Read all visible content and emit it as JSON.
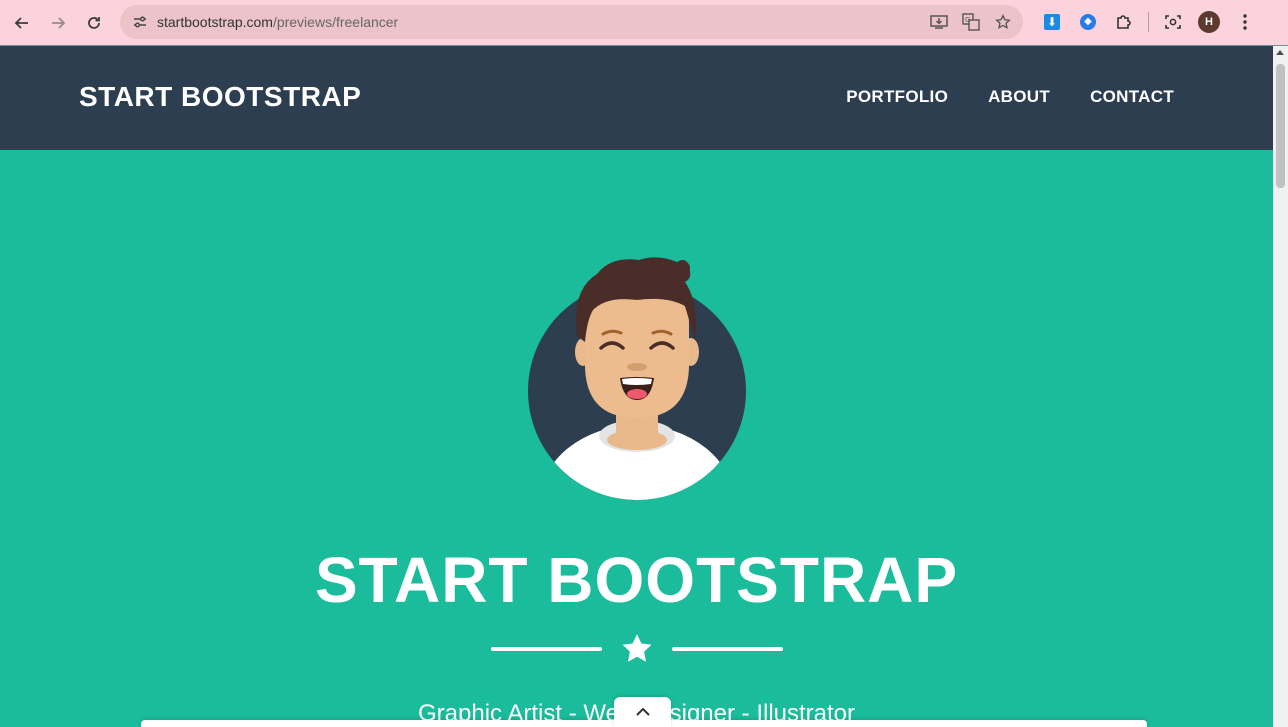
{
  "browser": {
    "url_host": "startbootstrap.com",
    "url_path": "/previews/freelancer",
    "profile_initial": "H"
  },
  "navbar": {
    "brand": "START BOOTSTRAP",
    "links": [
      "PORTFOLIO",
      "ABOUT",
      "CONTACT"
    ]
  },
  "hero": {
    "title": "START BOOTSTRAP",
    "subtitle": "Graphic Artist - Web Designer - Illustrator"
  },
  "colors": {
    "primary": "#1abc9c",
    "navbar": "#2c3e50",
    "chrome": "#fbd3dc"
  },
  "icons": {
    "back": "arrow-left-icon",
    "forward": "arrow-right-icon",
    "reload": "reload-icon",
    "site_info": "tune-icon",
    "install": "install-icon",
    "translate": "translate-icon",
    "bookmark": "star-icon",
    "downloader": "download-extension-icon",
    "drop": "drop-extension-icon",
    "extensions": "puzzle-icon",
    "screenshot": "screenshot-icon",
    "menu": "kebab-menu-icon",
    "divider": "star-icon",
    "scroll_top": "chevron-up-icon"
  }
}
